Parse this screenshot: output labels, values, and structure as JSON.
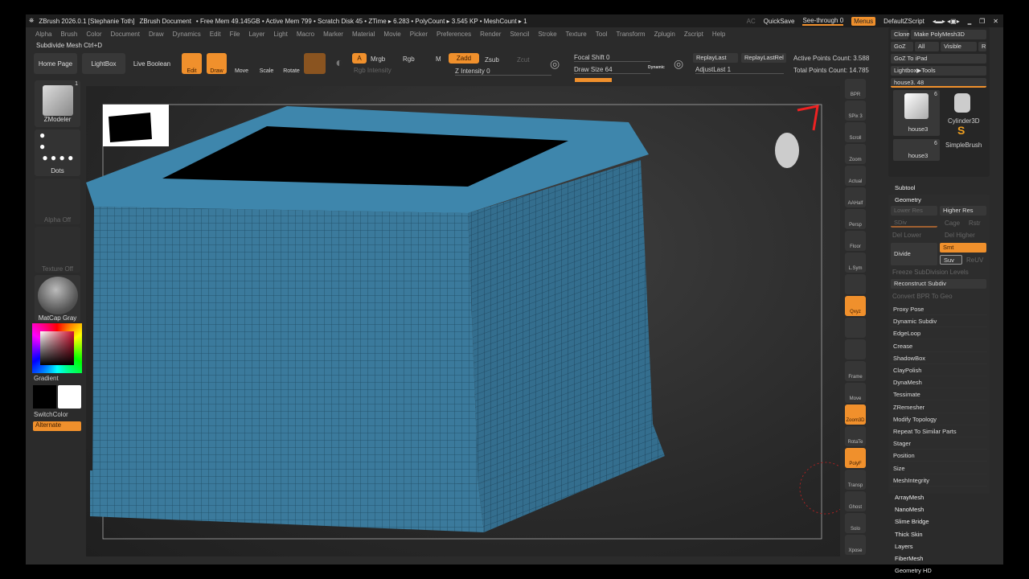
{
  "title": {
    "app": "ZBrush 2026.0.1 [Stephanie Toth]",
    "doc": "ZBrush Document",
    "stats": "• Free Mem 49.145GB • Active Mem 799 • Scratch Disk 45 • ZTime ▸ 6.283 • PolyCount ▸ 3.545 KP • MeshCount ▸ 1",
    "ac": "AC",
    "quicksave": "QuickSave",
    "seethrough": "See-through 0",
    "menus": "Menus",
    "script": "DefaultZScript"
  },
  "menu": [
    "Alpha",
    "Brush",
    "Color",
    "Document",
    "Draw",
    "Dynamics",
    "Edit",
    "File",
    "Layer",
    "Light",
    "Macro",
    "Marker",
    "Material",
    "Movie",
    "Picker",
    "Preferences",
    "Render",
    "Stencil",
    "Stroke",
    "Texture",
    "Tool",
    "Transform",
    "Zplugin",
    "Zscript",
    "Help"
  ],
  "hint": "Subdivide Mesh Ctrl+D",
  "toolbar": {
    "home": "Home Page",
    "lightbox": "LightBox",
    "liveboolean": "Live Boolean",
    "edit": "Edit",
    "draw": "Draw",
    "move": "Move",
    "scale": "Scale",
    "rotate": "Rotate",
    "a": "A",
    "mrgb": "Mrgb",
    "rgb": "Rgb",
    "m": "M",
    "rgbint": "Rgb Intensity",
    "zadd": "Zadd",
    "zsub": "Zsub",
    "zcut": "Zcut",
    "zint": "Z Intensity 0",
    "focal": "Focal Shift 0",
    "drawsize": "Draw Size 64",
    "dynamic": "Dynamic",
    "replay": "ReplayLast",
    "replayrel": "ReplayLastRel",
    "adjust": "AdjustLast 1",
    "active": "Active Points Count: 3.588",
    "total": "Total Points Count: 14.785"
  },
  "left": {
    "zmodeler": "ZModeler",
    "zcount": "1",
    "dots": "Dots",
    "alpha": "Alpha Off",
    "texture": "Texture Off",
    "matcap": "MatCap Gray",
    "gradient": "Gradient",
    "switch": "SwitchColor",
    "alternate": "Alternate"
  },
  "rshelf": [
    "BPR",
    "SPix 3",
    "Scroll",
    "Zoom",
    "Actual",
    "AAHalf",
    "Persp",
    "Floor",
    "L.Sym",
    "",
    "Qxyz",
    "",
    "",
    "Frame",
    "Move",
    "Zoom3D",
    "RotaTe",
    "PolyF",
    "Transp",
    "Ghost",
    "Solo",
    "Xpose"
  ],
  "rpanel": {
    "clone": "Clone",
    "make": "Make PolyMesh3D",
    "goz": "GoZ",
    "all": "All",
    "visible": "Visible",
    "r": "R",
    "gozipad": "GoZ To iPad",
    "lightboxtools": "Lightbox▶Tools",
    "house": "house3. 48",
    "tool1": "house3",
    "tool1n": "6",
    "cyl": "Cylinder3D",
    "simple": "SimpleBrush",
    "tool2": "house3",
    "tool2n": "6",
    "subtool": "Subtool",
    "geometry": "Geometry",
    "lower": "Lower Res",
    "higher": "Higher Res",
    "sdiv": "SDiv",
    "cage": "Cage",
    "rstr": "Rstr",
    "dellower": "Del Lower",
    "delhigher": "Del Higher",
    "divide": "Divide",
    "smt": "Smt",
    "suv": "Suv",
    "reuv": "ReUV",
    "freeze": "Freeze SubDivision Levels",
    "reconstruct": "Reconstruct Subdiv",
    "convert": "Convert BPR To Geo",
    "items": [
      "Proxy Pose",
      "Dynamic Subdiv",
      "EdgeLoop",
      "Crease",
      "ShadowBox",
      "ClayPolish",
      "DynaMesh",
      "Tessimate",
      "ZRemesher",
      "Modify Topology",
      "Repeat To Similar Parts",
      "Stager",
      "Position",
      "Size",
      "MeshIntegrity"
    ],
    "plugins": [
      "ArrayMesh",
      "NanoMesh",
      "Slime Bridge",
      "Thick Skin",
      "Layers",
      "FiberMesh",
      "Geometry HD"
    ]
  },
  "colors": {
    "accent": "#f0902c",
    "mesh": "#3b7a9c"
  }
}
